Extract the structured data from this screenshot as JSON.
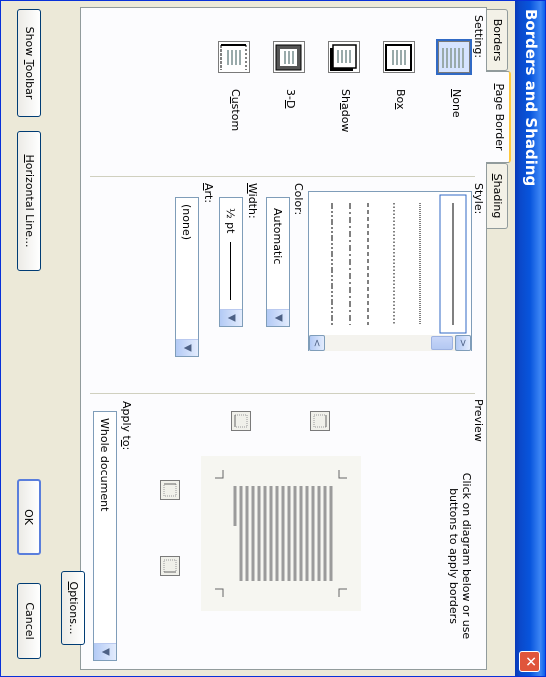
{
  "window": {
    "title": "Borders and Shading",
    "close_glyph": "✕"
  },
  "tabs": [
    {
      "label": "Borders",
      "active": false
    },
    {
      "label": "Page Border",
      "active": true
    },
    {
      "label": "Shading",
      "active": false
    }
  ],
  "setting": {
    "label": "Setting:",
    "options": [
      {
        "label": "None",
        "selected": true
      },
      {
        "label": "Box",
        "selected": false
      },
      {
        "label": "Shadow",
        "selected": false
      },
      {
        "label": "3-D",
        "selected": false
      },
      {
        "label": "Custom",
        "selected": false
      }
    ]
  },
  "style": {
    "label": "Style:",
    "line_styles": [
      "solid",
      "dotted-fine",
      "dotted",
      "dashed",
      "dash-dot",
      "dash-dot-dot"
    ],
    "scroll_left": "<",
    "scroll_right": ">"
  },
  "color": {
    "label": "Color:",
    "value": "Automatic"
  },
  "width": {
    "label": "Width:",
    "value": "½ pt"
  },
  "art": {
    "label": "Art:",
    "value": "(none)"
  },
  "preview": {
    "label": "Preview",
    "instruction_line1": "Click on diagram below or use",
    "instruction_line2": "buttons to apply borders"
  },
  "apply_to": {
    "label": "Apply to:",
    "value": "Whole document"
  },
  "buttons": {
    "options": "Options...",
    "show_toolbar": "Show Toolbar",
    "horizontal_line": "Horizontal Line...",
    "ok": "OK",
    "cancel": "Cancel"
  },
  "colors": {
    "title_bar": "#0a5fea",
    "dialog_bg": "#ece9d8",
    "selection": "#316ac5",
    "tab_highlight": "#ffc83c"
  }
}
